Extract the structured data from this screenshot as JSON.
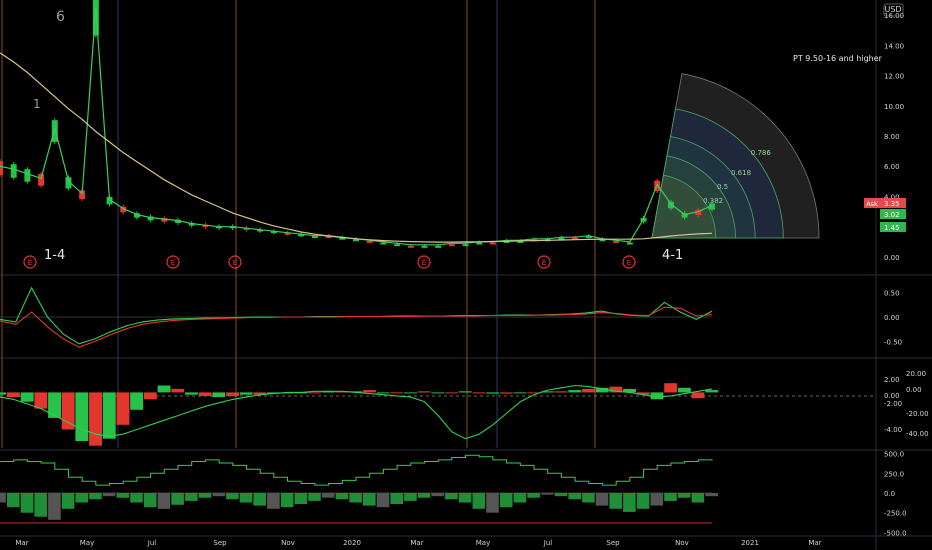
{
  "chart_data": {
    "type": "line",
    "currency": "USD",
    "x_tick_labels": [
      "Mar",
      "May",
      "Jul",
      "Sep",
      "Nov",
      "2020",
      "Mar",
      "May",
      "Jul",
      "Sep",
      "Nov",
      "2021",
      "Mar"
    ],
    "price_axis": {
      "ylim": [
        -1,
        17
      ],
      "ticks": [
        "16.00",
        "14.00",
        "12.00",
        "10.00",
        "8.00",
        "6.00",
        "4.00",
        "2.00",
        "0.00"
      ]
    },
    "price_badges": [
      {
        "label": "Ask",
        "value": "3.35",
        "color": "#e84a4a"
      },
      {
        "label": "",
        "value": "3.02",
        "color": "#2fb84e"
      },
      {
        "label": "",
        "value": "1.45",
        "color": "#2fb84e"
      }
    ],
    "annotation": "PT 9.50-16 and higher",
    "wave_labels": [
      "6",
      "1",
      "1-4",
      "4-1"
    ],
    "earnings_marker": "E",
    "fib_levels": [
      {
        "label": "0.382",
        "value": 0.382
      },
      {
        "label": "0.5",
        "value": 0.5
      },
      {
        "label": "0.618",
        "value": 0.618
      },
      {
        "label": "0.786",
        "value": 0.786
      },
      {
        "label": "1",
        "value": 1
      }
    ],
    "series": [
      {
        "values": [
          6.0,
          5.8,
          5.5,
          5.2,
          8.5,
          5.0,
          4.2,
          16.5,
          3.8,
          3.2,
          2.8,
          2.6,
          2.5,
          2.4,
          2.2,
          2.1,
          2.0,
          2.0,
          1.9,
          1.8,
          1.7,
          1.6,
          1.5,
          1.4,
          1.4,
          1.3,
          1.2,
          1.1,
          1.0,
          0.9,
          0.8,
          0.8,
          0.8,
          0.9,
          0.9,
          1.0,
          1.0,
          1.1,
          1.1,
          1.2,
          1.2,
          1.3,
          1.3,
          1.4,
          1.2,
          1.1,
          1.0,
          2.5,
          4.8,
          3.5,
          2.8,
          3.0,
          3.4
        ]
      },
      {
        "values": [
          13.5,
          12.9,
          12.2,
          11.4,
          10.6,
          9.8,
          9.1,
          8.3,
          7.6,
          6.9,
          6.3,
          5.7,
          5.1,
          4.6,
          4.1,
          3.7,
          3.3,
          2.9,
          2.6,
          2.3,
          2.05,
          1.85,
          1.65,
          1.5,
          1.38,
          1.28,
          1.2,
          1.13,
          1.08,
          1.04,
          1.01,
          0.99,
          0.98,
          0.98,
          0.99,
          1.0,
          1.02,
          1.04,
          1.06,
          1.08,
          1.1,
          1.12,
          1.14,
          1.16,
          1.17,
          1.17,
          1.17,
          1.2,
          1.28,
          1.38,
          1.46,
          1.52,
          1.56
        ]
      }
    ],
    "oscillator1": {
      "ticks": [
        "0.50",
        "0.00",
        "-0.50"
      ],
      "ylim": [
        -0.8,
        0.8
      ],
      "line_a": [
        -0.05,
        -0.1,
        0.6,
        0.0,
        -0.35,
        -0.55,
        -0.45,
        -0.3,
        -0.18,
        -0.1,
        -0.06,
        -0.04,
        -0.03,
        -0.02,
        -0.02,
        -0.01,
        0.0,
        0.0,
        0.0,
        0.0,
        0.01,
        0.01,
        0.01,
        0.01,
        0.01,
        0.02,
        0.02,
        0.02,
        0.02,
        0.03,
        0.03,
        0.03,
        0.04,
        0.04,
        0.04,
        0.05,
        0.06,
        0.08,
        0.12,
        0.06,
        0.03,
        0.02,
        0.3,
        0.1,
        -0.05,
        0.12
      ],
      "line_b": [
        -0.08,
        -0.15,
        0.1,
        -0.2,
        -0.45,
        -0.62,
        -0.5,
        -0.36,
        -0.24,
        -0.15,
        -0.1,
        -0.07,
        -0.05,
        -0.04,
        -0.03,
        -0.02,
        -0.01,
        -0.01,
        0.0,
        0.0,
        0.0,
        0.0,
        0.01,
        0.01,
        0.01,
        0.01,
        0.01,
        0.02,
        0.02,
        0.02,
        0.02,
        0.03,
        0.03,
        0.03,
        0.04,
        0.04,
        0.05,
        0.06,
        0.09,
        0.07,
        0.04,
        0.03,
        0.2,
        0.18,
        0.02,
        0.05
      ]
    },
    "oscillator2": {
      "ticks": [
        "20.00",
        "0.00",
        "-20.00",
        "-40.00"
      ],
      "axis_extra_ticks": [
        "2.00",
        "0.00",
        "-2.00",
        "-4.00"
      ],
      "ylim": [
        -48,
        28
      ],
      "histogram": [
        -2,
        -4,
        -8,
        -14,
        -22,
        -32,
        -42,
        -46,
        -40,
        -28,
        -15,
        -6,
        6,
        3,
        -2,
        -3,
        -4,
        -3,
        -2,
        -2,
        -1,
        -1,
        0,
        0,
        1,
        1,
        1,
        2,
        0,
        0,
        0,
        1,
        0,
        0,
        1,
        0,
        -1,
        -1,
        0,
        0,
        1,
        1,
        2,
        3,
        4,
        5,
        3,
        -2,
        -6,
        8,
        4,
        -5,
        2
      ],
      "signal": [
        -4,
        -6,
        -10,
        -14,
        -20,
        -26,
        -32,
        -36,
        -38,
        -36,
        -32,
        -28,
        -24,
        -20,
        -16,
        -12,
        -9,
        -6,
        -4,
        -2,
        -1,
        0,
        0,
        1,
        1,
        1,
        0,
        -1,
        -2,
        -3,
        -4,
        -8,
        -20,
        -34,
        -40,
        -36,
        -28,
        -18,
        -8,
        -2,
        2,
        4,
        6,
        5,
        3,
        1,
        0,
        -2,
        -4,
        -3,
        -1,
        1,
        3
      ]
    },
    "oscillator3": {
      "ticks": [
        "500.0",
        "250.0",
        "0.0",
        "-250.0",
        "-500.0"
      ],
      "ylim": [
        -520,
        520
      ],
      "step": [
        400,
        420,
        400,
        380,
        300,
        200,
        150,
        100,
        120,
        150,
        200,
        250,
        300,
        350,
        400,
        420,
        380,
        350,
        300,
        250,
        200,
        150,
        120,
        100,
        120,
        160,
        200,
        250,
        300,
        350,
        380,
        400,
        420,
        450,
        480,
        460,
        420,
        380,
        350,
        300,
        250,
        200,
        150,
        120,
        100,
        150,
        200,
        300,
        350,
        380,
        400,
        420,
        430
      ],
      "bars": [
        -120,
        -180,
        -250,
        -300,
        -340,
        -200,
        -120,
        -80,
        -40,
        -60,
        -120,
        -180,
        -200,
        -150,
        -100,
        -60,
        -40,
        -80,
        -120,
        -160,
        -200,
        -180,
        -140,
        -100,
        -60,
        -80,
        -120,
        -160,
        -180,
        -140,
        -100,
        -60,
        -40,
        -80,
        -120,
        -200,
        -250,
        -180,
        -120,
        -60,
        -20,
        -40,
        -80,
        -120,
        -160,
        -200,
        -240,
        -200,
        -160,
        -100,
        -60,
        -120,
        -40
      ]
    }
  }
}
